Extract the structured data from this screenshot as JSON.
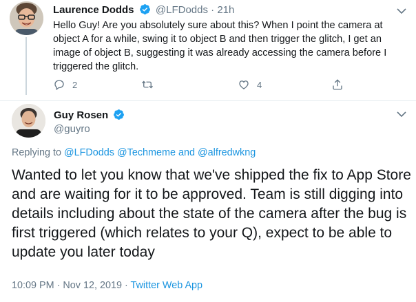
{
  "tweet1": {
    "author_name": "Laurence Dodds",
    "handle": "@LFDodds",
    "separator": "·",
    "time": "21h",
    "text": "Hello Guy! Are you absolutely sure about this? When I point the camera at object A for a while, swing it to object B and then trigger the glitch, I get an image of object B, suggesting it was already accessing the camera before I triggered the glitch.",
    "reply_count": "2",
    "like_count": "4",
    "icons": [
      "verified-badge-icon",
      "chevron-down-icon",
      "reply-icon",
      "retweet-icon",
      "like-icon",
      "share-icon"
    ]
  },
  "tweet2": {
    "author_name": "Guy Rosen",
    "handle": "@guyro",
    "replying_prefix": "Replying to",
    "mentions": [
      "@LFDodds",
      "@Techmeme",
      "@alfredwkng"
    ],
    "and_word": "and",
    "text": "Wanted to let you know that we've shipped the fix to App Store and are waiting for it to be approved. Team is still digging into details including about the state of the camera after the bug is first triggered (which relates to your Q), expect to be able to update you later today",
    "timestamp": "10:09 PM · Nov 12, 2019 ·",
    "source": "Twitter Web App"
  },
  "colors": {
    "text": "#14171a",
    "muted": "#657786",
    "link": "#1b95e0",
    "verified": "#1da1f2",
    "divider": "#e6ecf0"
  }
}
